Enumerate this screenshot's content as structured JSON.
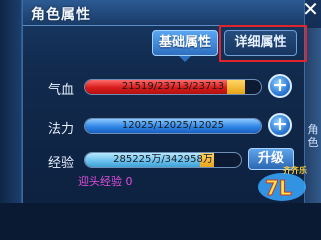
{
  "window": {
    "title": "角色属性",
    "close_symbol": "✕"
  },
  "tabs": [
    {
      "label": "基础属性",
      "active": true
    },
    {
      "label": "详细属性",
      "active": false
    }
  ],
  "stats": {
    "hp": {
      "label": "气血",
      "text": "21519/23713/23713",
      "fill_fraction": 0.91
    },
    "mp": {
      "label": "法力",
      "text": "12025/12025/12025",
      "fill_fraction": 1.0
    },
    "xp": {
      "label": "经验",
      "text": "285225万/342958万",
      "fill_fraction": 0.83
    }
  },
  "buttons": {
    "plus_symbol": "+",
    "upgrade_label": "升级"
  },
  "xp_note": "迎头经验  0",
  "side_text": "角色",
  "watermark": {
    "logo_text": "7L",
    "site_text": "齐齐乐"
  },
  "colors": {
    "hp": "#d81c1c",
    "mp": "#2f86e6",
    "xp": "#6cc2ef",
    "highlight": "#e0242b",
    "xp_note": "#e14fe0"
  }
}
